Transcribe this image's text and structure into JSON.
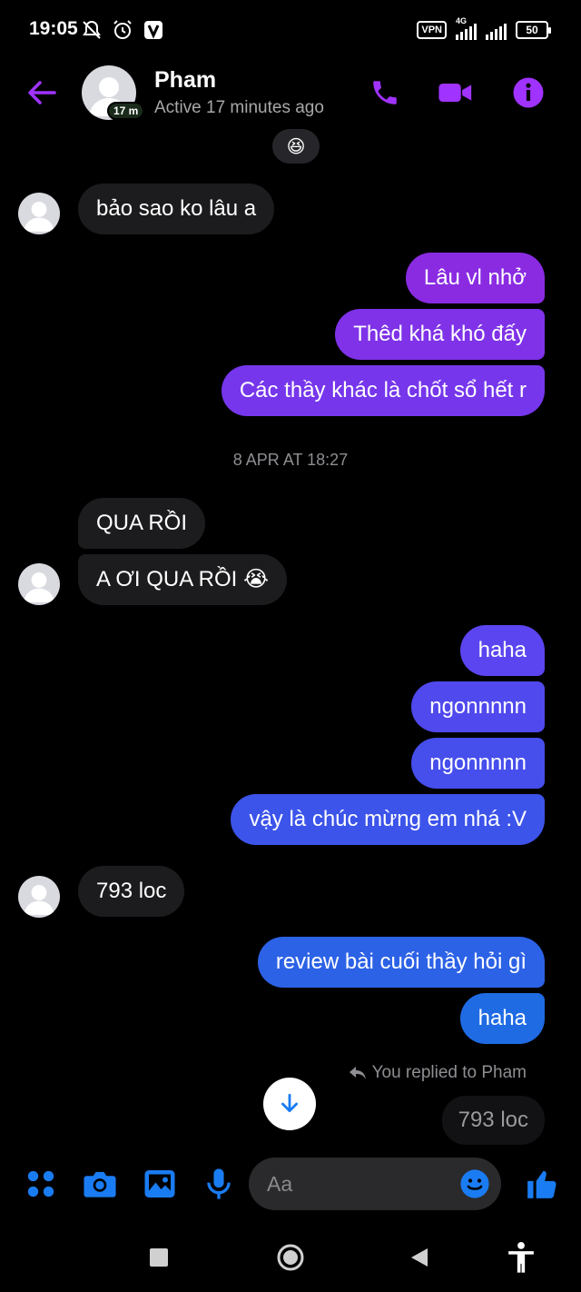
{
  "status_bar": {
    "time": "19:05",
    "vpn": "VPN",
    "network": "4G",
    "battery": "50"
  },
  "header": {
    "name": "Pham",
    "active_status": "Active 17 minutes ago",
    "avatar_badge": "17 m",
    "accent_color": "#a033ff"
  },
  "messages": {
    "reaction_emoji": "😆",
    "in_1": "bảo sao ko lâu a",
    "out_1": "Lâu vl nhở",
    "out_2": "Thêd khá khó đấy",
    "out_3": "Các thầy khác là chốt sổ hết r",
    "date_divider": "8 APR AT 18:27",
    "in_2": "QUA RỒI",
    "in_3": "A ƠI QUA RỒI 😭",
    "out_4": "haha",
    "out_5": "ngonnnnn",
    "out_6": "ngonnnnn",
    "out_7": "vậy là chúc mừng em nhá :V",
    "in_4": "793 loc",
    "out_8": "review bài cuối thầy hỏi gì",
    "out_9": "haha",
    "replied_label": "You replied to Pham",
    "reply_quote": "793 loc"
  },
  "composer": {
    "placeholder": "Aa"
  },
  "colors": {
    "bubble_purple": "#8a2be2",
    "bubble_violet": "#6a3cf0",
    "bubble_blue": "#2f5ee8",
    "icon_blue": "#1a7cf2"
  }
}
